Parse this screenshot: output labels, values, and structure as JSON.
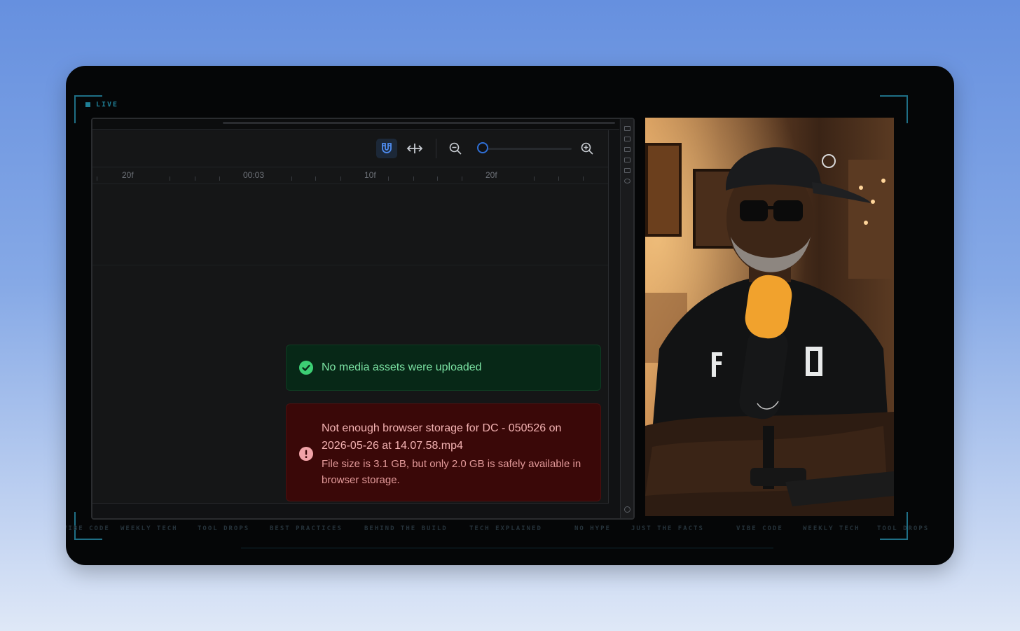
{
  "overlay": {
    "live_label": "LIVE",
    "ticker_items": [
      "VIBE CODE",
      "WEEKLY TECH",
      "TOOL DROPS",
      "BEST PRACTICES",
      "BEHIND THE BUILD",
      "TECH EXPLAINED",
      "NO HYPE",
      "JUST THE FACTS",
      "VIBE CODE",
      "WEEKLY TECH",
      "TOOL DROPS"
    ]
  },
  "timeline": {
    "ruler_labels": [
      "20f",
      "00:03",
      "10f",
      "20f"
    ],
    "tools": [
      "magnet-snap-icon",
      "move-horizontal-icon",
      "zoom-out-icon",
      "zoom-in-icon"
    ],
    "zoom_level": 0.05
  },
  "toasts": {
    "success": {
      "message": "No media assets were uploaded",
      "color": "#7be3a3"
    },
    "error": {
      "title": "Not enough browser storage for DC - 050526 on 2026-05-26 at 14.07.58.mp4",
      "body": "File size is 3.1 GB, but only 2.0 GB is safely available in browser storage.",
      "color": "#f3b2b2"
    }
  },
  "colors": {
    "accent": "#2f6fd6",
    "frame_bracket": "#1f6f86",
    "success_bg": "#072817",
    "error_bg": "#3a0808"
  }
}
